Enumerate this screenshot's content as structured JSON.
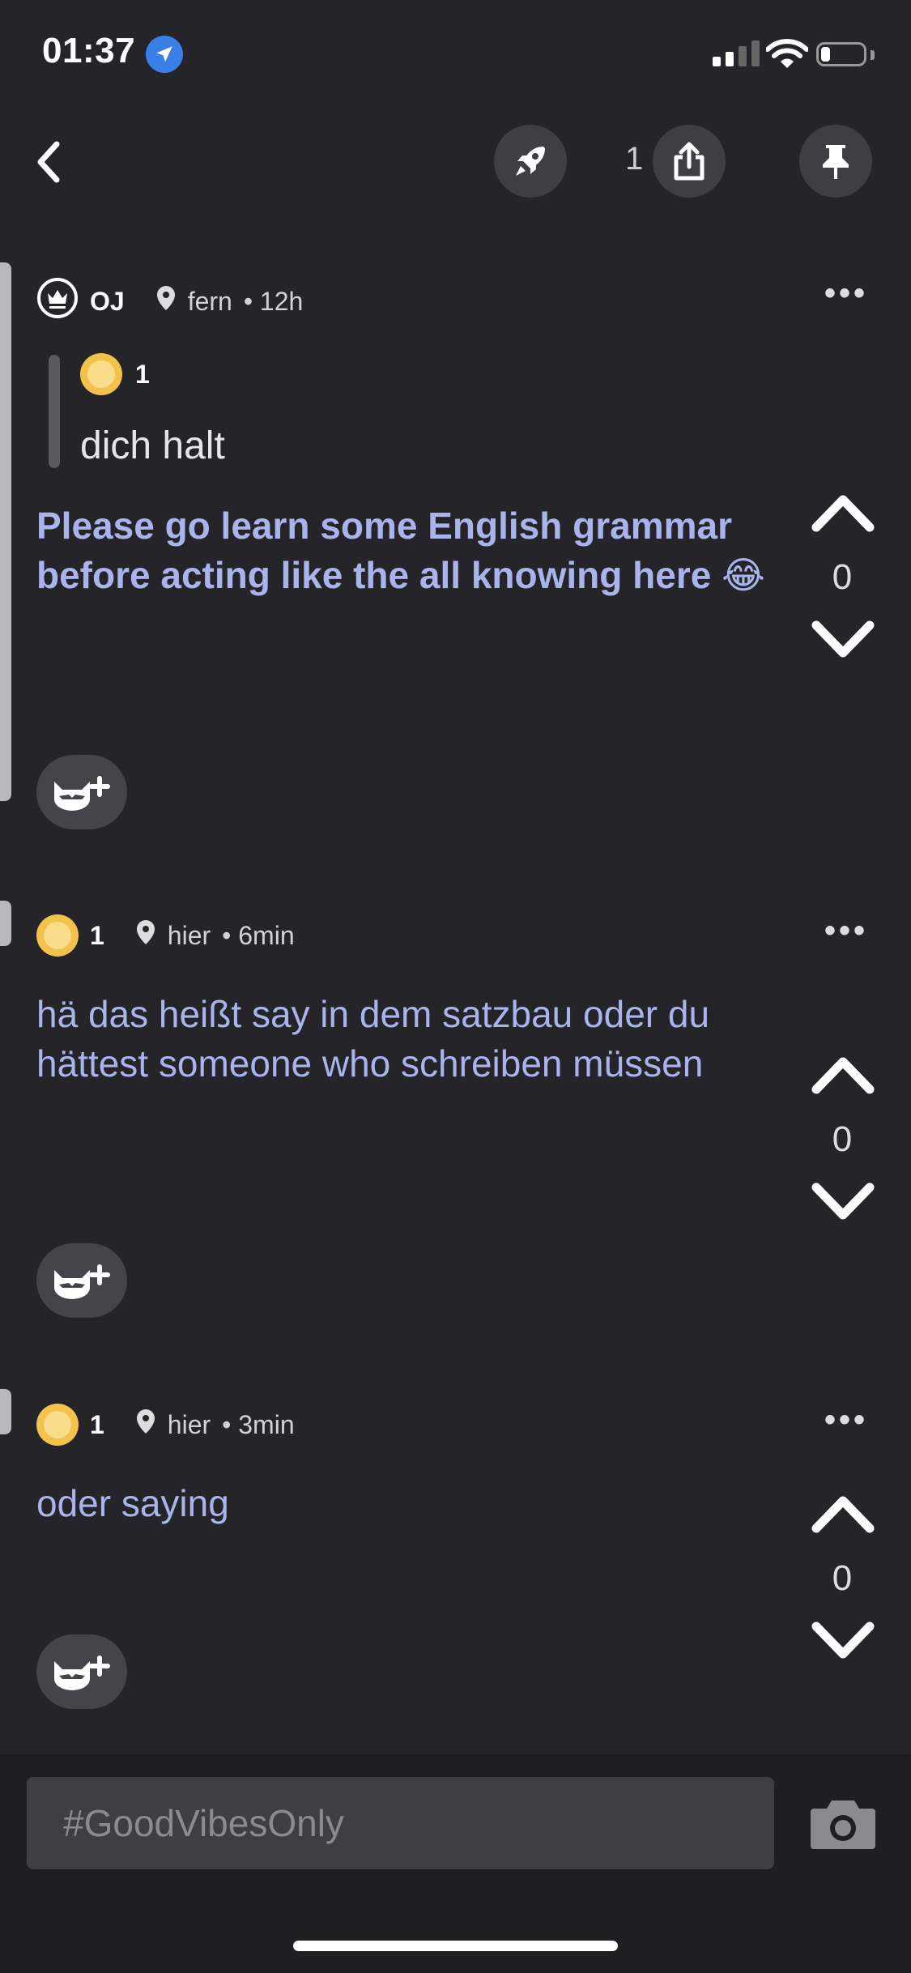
{
  "status_bar": {
    "time": "01:37",
    "battery_level": 0.2,
    "signal_bars_active": 2,
    "signal_bars_total": 4
  },
  "header": {
    "share_count": "1",
    "icons": [
      "back-chevron-icon",
      "rocket-icon",
      "share-icon",
      "pin-icon"
    ]
  },
  "threads": [
    {
      "username": "OJ",
      "location": "fern",
      "time": "• 12h",
      "quote": {
        "user_badge": "1",
        "text": "dich halt"
      },
      "text": "Please go learn some English grammar before acting like the all knowing here 😂",
      "bold": true,
      "votes": "0"
    },
    {
      "username": "1",
      "location": "hier",
      "time": "• 6min",
      "text": "hä das heißt say in dem satzbau oder du hättest someone who schreiben müssen",
      "bold": false,
      "votes": "0"
    },
    {
      "username": "1",
      "location": "hier",
      "time": "• 3min",
      "text": "oder saying",
      "bold": false,
      "votes": "0"
    }
  ],
  "composer": {
    "placeholder": "#GoodVibesOnly"
  },
  "colors": {
    "background": "#252529",
    "accent_text": "#a9b3ec",
    "button_bg": "#3e3e43",
    "avatar": "#f2c24a"
  }
}
